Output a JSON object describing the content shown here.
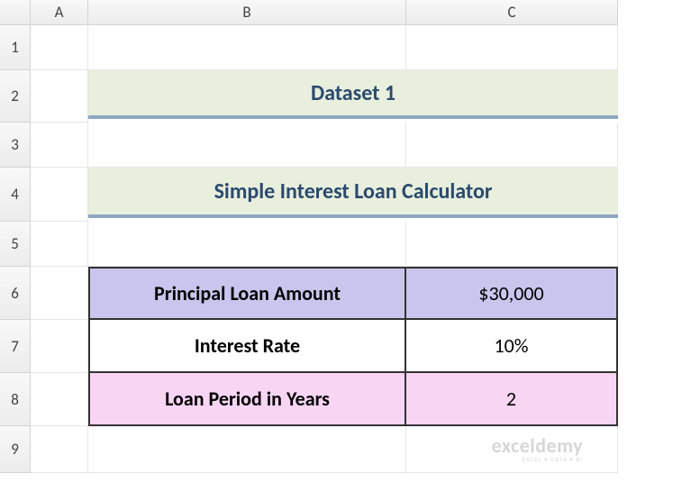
{
  "columns": {
    "A": "A",
    "B": "B",
    "C": "C"
  },
  "rows": {
    "1": "1",
    "2": "2",
    "3": "3",
    "4": "4",
    "5": "5",
    "6": "6",
    "7": "7",
    "8": "8",
    "9": "9"
  },
  "banner1": "Dataset 1",
  "banner2": "Simple Interest Loan Calculator",
  "table": {
    "r1": {
      "label": "Principal Loan Amount",
      "value": "$30,000"
    },
    "r2": {
      "label": "Interest Rate",
      "value": "10%"
    },
    "r3": {
      "label": "Loan Period in Years",
      "value": "2"
    }
  },
  "watermark": {
    "brand": "exceldemy",
    "tag": "EXCEL • DATA • BI"
  }
}
